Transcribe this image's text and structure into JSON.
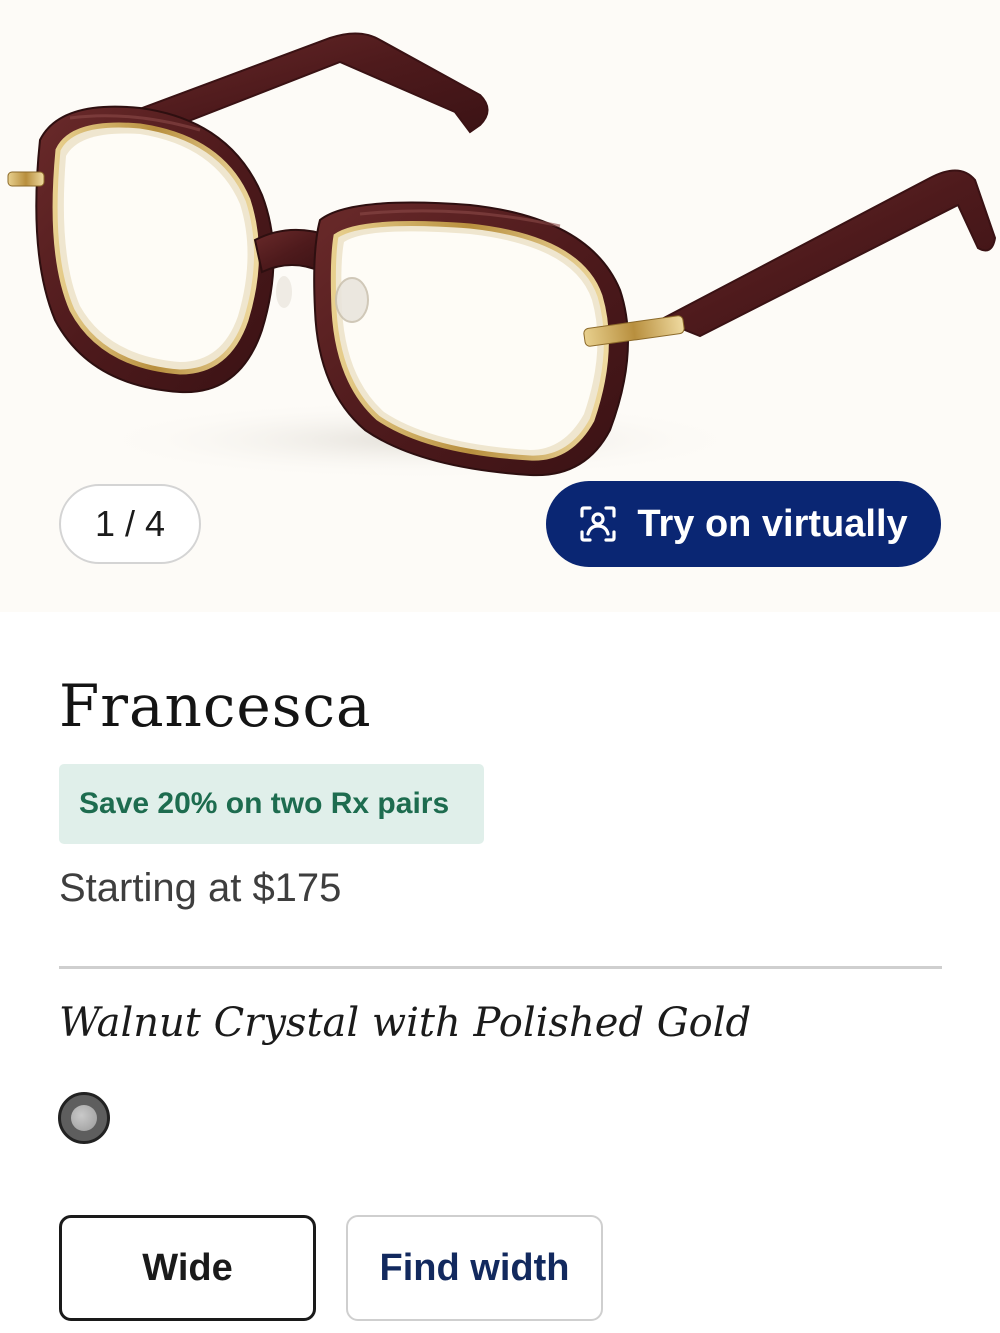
{
  "gallery": {
    "pager_label": "1 / 4",
    "image_alt": "Francesca eyeglasses in Walnut Crystal with Polished Gold",
    "frame_color": "#5a1f1f",
    "rim_accent_color": "#c8a65a"
  },
  "try_on": {
    "label": "Try on virtually",
    "icon": "face-scan-icon",
    "background_color": "#0a2673"
  },
  "product": {
    "name": "Francesca",
    "promo": "Save 20% on two Rx pairs",
    "price": "Starting at $175",
    "color_name": "Walnut Crystal with Polished Gold"
  },
  "swatches": [
    {
      "name": "Walnut Crystal with Polished Gold",
      "selected": true
    }
  ],
  "width_options": {
    "selected_label": "Wide",
    "find_width_label": "Find width"
  },
  "colors": {
    "promo_bg": "#e0efea",
    "promo_text": "#1d6c4f",
    "find_width_text": "#12295e"
  }
}
